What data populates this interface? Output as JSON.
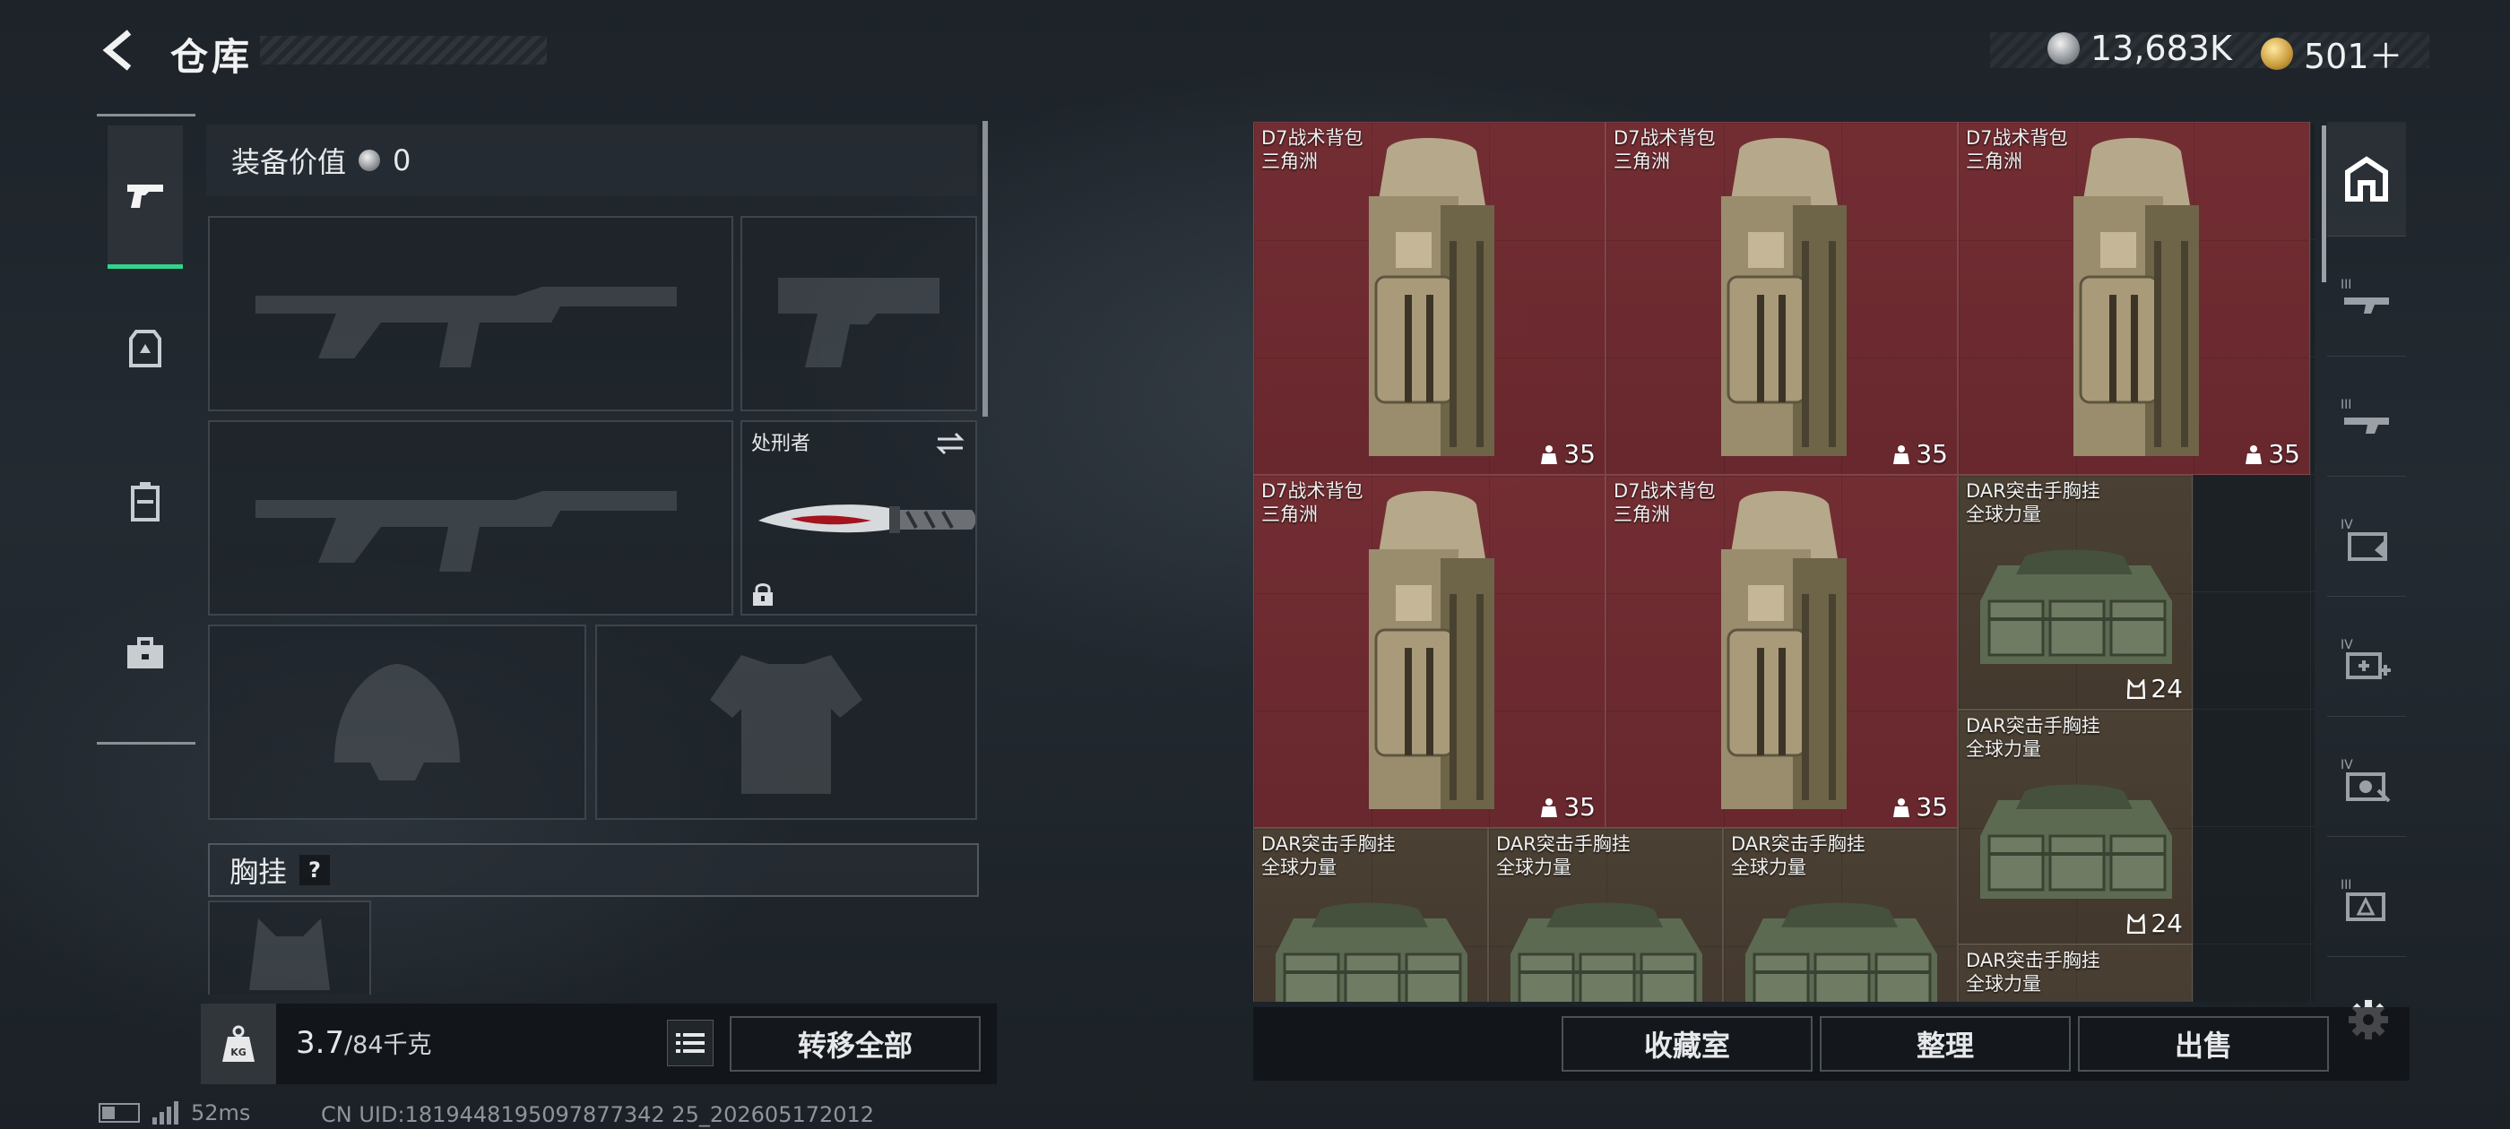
{
  "header": {
    "title": "仓库",
    "currency": [
      {
        "icon": "silver-coin-icon",
        "amount": "13,683K"
      },
      {
        "icon": "gold-coin-icon",
        "amount": "501＋"
      }
    ]
  },
  "left_rail": {
    "tabs": [
      {
        "icon": "pistol-icon",
        "active": true
      },
      {
        "icon": "armor-icon",
        "active": false
      },
      {
        "icon": "backpack-icon",
        "active": false
      },
      {
        "icon": "toolbox-icon",
        "active": false
      }
    ]
  },
  "loadout": {
    "value_label": "装备价值",
    "value": "0",
    "knife": {
      "name": "处刑者",
      "locked": true
    },
    "chest_rig_label": "胸挂",
    "chest_rig_help": "?"
  },
  "weight": {
    "current": "3.7",
    "max": "/84千克",
    "transfer_all_label": "转移全部"
  },
  "status": {
    "ping": "52ms",
    "uid": "CN UID:1819448195097877342 25_202605172012"
  },
  "storage": {
    "items": [
      {
        "name": "D7战术背包",
        "sub": "三角洲",
        "count": "35",
        "kind": "bag",
        "rarity": "red"
      },
      {
        "name": "D7战术背包",
        "sub": "三角洲",
        "count": "35",
        "kind": "bag",
        "rarity": "red"
      },
      {
        "name": "D7战术背包",
        "sub": "三角洲",
        "count": "35",
        "kind": "bag",
        "rarity": "red"
      },
      {
        "name": "D7战术背包",
        "sub": "三角洲",
        "count": "35",
        "kind": "bag",
        "rarity": "red"
      },
      {
        "name": "D7战术背包",
        "sub": "三角洲",
        "count": "35",
        "kind": "bag",
        "rarity": "red"
      },
      {
        "name": "DAR突击手胸挂",
        "sub": "全球力量",
        "count": "24",
        "kind": "rig",
        "rarity": "brown"
      },
      {
        "name": "DAR突击手胸挂",
        "sub": "全球力量",
        "count": "24",
        "kind": "rig",
        "rarity": "brown"
      },
      {
        "name": "DAR突击手胸挂",
        "sub": "全球力量",
        "count": "",
        "kind": "rig",
        "rarity": "brown"
      },
      {
        "name": "DAR突击手胸挂",
        "sub": "全球力量",
        "count": "",
        "kind": "rig",
        "rarity": "brown"
      },
      {
        "name": "DAR突击手胸挂",
        "sub": "全球力量",
        "count": "",
        "kind": "rig",
        "rarity": "brown"
      },
      {
        "name": "DAR突击手胸挂",
        "sub": "全球力量",
        "count": "",
        "kind": "rig",
        "rarity": "brown"
      }
    ]
  },
  "right_rail": {
    "tabs": [
      {
        "icon": "home-storage-icon",
        "active": true
      },
      {
        "icon": "tier-3-rifle-icon",
        "tier": "III"
      },
      {
        "icon": "tier-3-rifle-icon-2",
        "tier": "III"
      },
      {
        "icon": "tier-4-folder-icon",
        "tier": "IV"
      },
      {
        "icon": "tier-4-medkit-icon",
        "tier": "IV"
      },
      {
        "icon": "tier-4-tool-icon",
        "tier": "IV"
      },
      {
        "icon": "tier-3-alert-icon",
        "tier": "III"
      }
    ]
  },
  "actions": {
    "collection_label": "收藏室",
    "sort_label": "整理",
    "sell_label": "出售"
  }
}
